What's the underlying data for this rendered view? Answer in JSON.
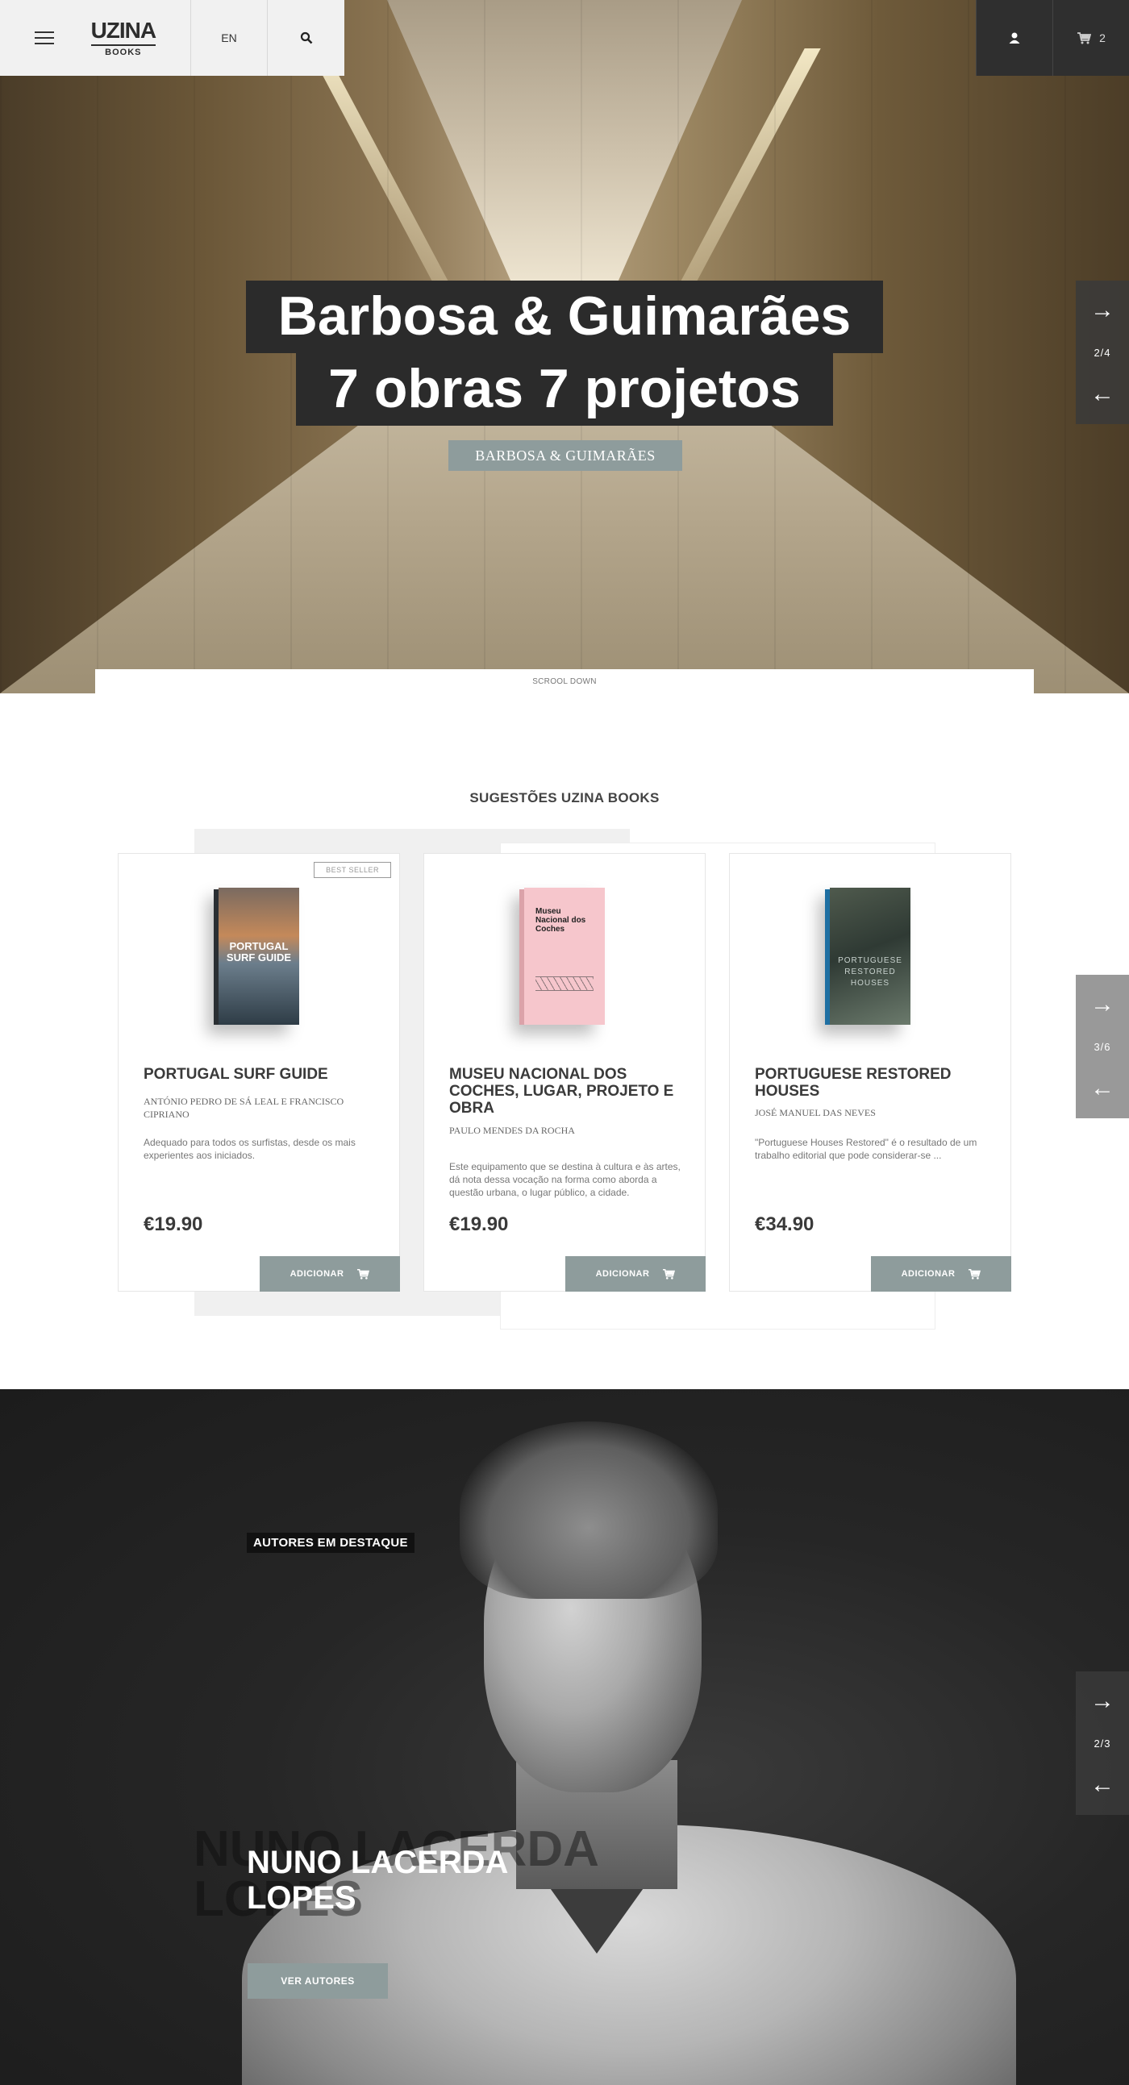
{
  "header": {
    "logo_main": "UZINA",
    "logo_sub": "BOOKS",
    "lang": "EN",
    "cart_count": "2",
    "icons": [
      "menu-icon",
      "search-icon",
      "user-icon",
      "cart-icon"
    ]
  },
  "hero": {
    "title_line1": "Barbosa & Guimarães",
    "title_line2": "7 obras 7 projetos",
    "button": "BARBOSA & GUIMARÃES",
    "slide_counter": "2/4",
    "scroll_down": "SCROOL DOWN"
  },
  "suggestions": {
    "title": "SUGESTÕES UZINA BOOKS",
    "slide_counter": "3/6",
    "add_label": "ADICIONAR",
    "cards": [
      {
        "badge": "BEST SELLER",
        "cover_text": "PORTUGAL SURF GUIDE",
        "title": "PORTUGAL SURF GUIDE",
        "author": "ANTÓNIO PEDRO DE SÁ LEAL E FRANCISCO CIPRIANO",
        "description": "Adequado para todos os surfistas, desde os mais experientes aos iniciados.",
        "price": "€19.90"
      },
      {
        "cover_text": "Museu Nacional dos Coches",
        "title": "MUSEU NACIONAL DOS COCHES, LUGAR, PROJETO E OBRA",
        "author": "PAULO MENDES DA ROCHA",
        "description": "Este equipamento que se destina à cultura e às artes, dá nota dessa vocação na forma como aborda a questão urbana, o lugar público, a cidade.",
        "price": "€19.90"
      },
      {
        "cover_text": "PORTUGUESE RESTORED HOUSES",
        "title": "PORTUGUESE RESTORED HOUSES",
        "author": "JOSÉ MANUEL DAS NEVES",
        "description": "\"Portuguese Houses Restored\" é o resultado de um trabalho editorial que pode considerar-se ...",
        "price": "€34.90"
      }
    ]
  },
  "authors": {
    "label": "AUTORES EM DESTAQUE",
    "name_line1": "NUNO LACERDA",
    "name_line2": "LOPES",
    "ghost_line1": "NUNO LACERDA",
    "ghost_line2": "LOPES",
    "button": "VER AUTORES",
    "slide_counter": "2/3"
  }
}
